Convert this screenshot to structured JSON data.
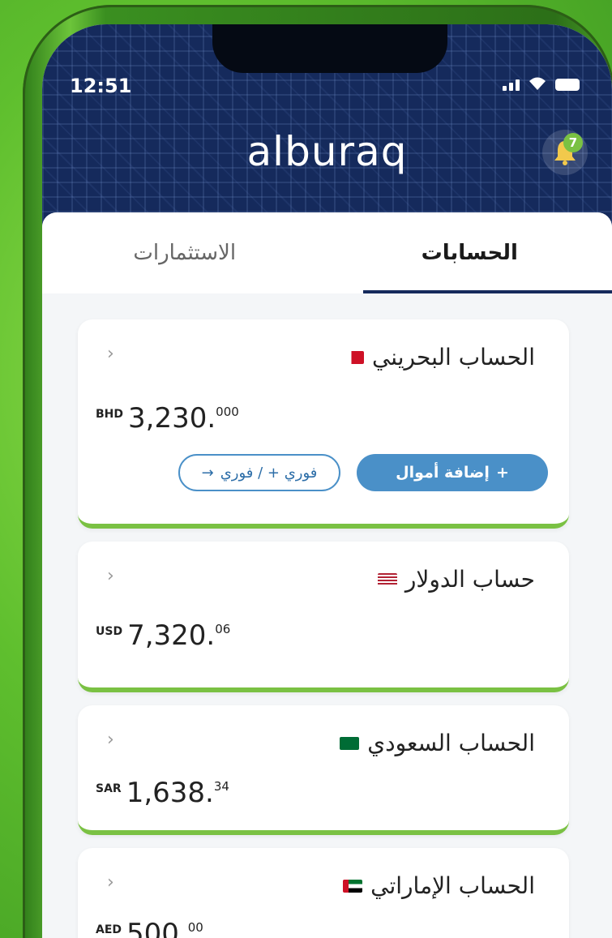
{
  "status_bar": {
    "time": "12:51"
  },
  "header": {
    "brand": "alburaq",
    "notification_count": "7"
  },
  "tabs": [
    {
      "label": "الاستثمارات",
      "active": false
    },
    {
      "label": "الحسابات",
      "active": true
    }
  ],
  "accounts": [
    {
      "name": "الحساب البحريني",
      "flag": "bahrain-flag-icon",
      "currency": "BHD",
      "amount": "3,230.",
      "cents": "000",
      "actions": {
        "transfer": "فوري + / فوري",
        "add_funds": "إضافة أموال"
      }
    },
    {
      "name": "حساب الدولار",
      "flag": "usa-flag-icon",
      "currency": "USD",
      "amount": "7,320.",
      "cents": "06"
    },
    {
      "name": "الحساب السعودي",
      "flag": "saudi-flag-icon",
      "currency": "SAR",
      "amount": "1,638.",
      "cents": "34"
    },
    {
      "name": "الحساب الإماراتي",
      "flag": "uae-flag-icon",
      "currency": "AED",
      "amount": "500.",
      "cents": "00"
    }
  ],
  "colors": {
    "header_bg": "#152a5c",
    "accent_green": "#7ac143",
    "button_blue": "#4a90c8"
  }
}
